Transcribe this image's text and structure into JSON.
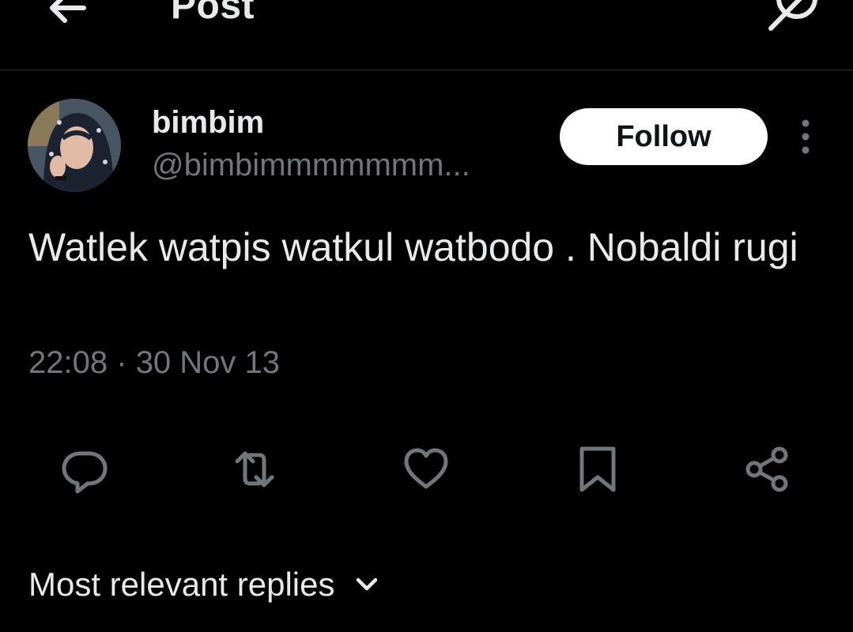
{
  "header": {
    "title": "Post",
    "icons": [
      "back-arrow-icon",
      "grok-icon"
    ]
  },
  "post": {
    "author_name": "bimbim",
    "author_handle": "@bimbimmmmmmm...",
    "follow_label": "Follow",
    "text": "Watlek watpis watkul watbodo . Nobaldi rugi",
    "time": "22:08",
    "separator": "·",
    "date": "30 Nov 13"
  },
  "actions": [
    "reply-icon",
    "repost-icon",
    "like-icon",
    "bookmark-icon",
    "share-icon"
  ],
  "replies": {
    "sort_label": "Most relevant replies"
  },
  "colors": {
    "background": "#000000",
    "text": "#e7e9ea",
    "secondary": "#71767b",
    "divider": "#2f3336",
    "follow_bg": "#ffffff"
  }
}
